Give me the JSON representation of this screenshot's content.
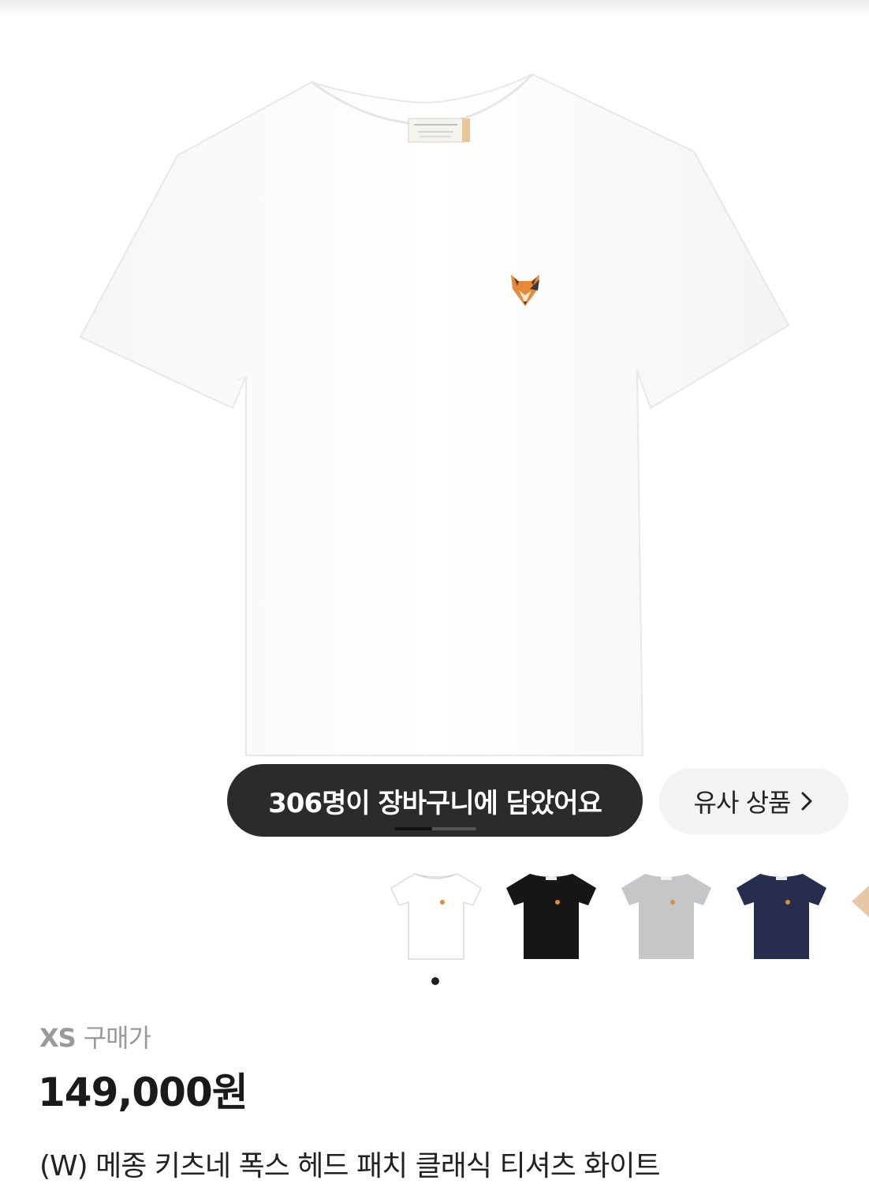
{
  "cart_banner": {
    "text": "306명이 장바구니에 담았어요"
  },
  "similar_button": {
    "label": "유사 상품",
    "icon": "chevron-right-icon"
  },
  "gallery": {
    "page_index": 1,
    "page_count": 2
  },
  "color_options": [
    {
      "name": "white",
      "color": "#ffffff"
    },
    {
      "name": "black",
      "color": "#161616"
    },
    {
      "name": "gray",
      "color": "#c4c6c8"
    },
    {
      "name": "navy",
      "color": "#262d4d"
    },
    {
      "name": "beige",
      "color": "#e6c9a4"
    }
  ],
  "color_dots": {
    "active_index": 0
  },
  "product": {
    "size": "XS",
    "price_label": "구매가",
    "price": "149,000원",
    "title": "(W) 메종 키츠네 폭스 헤드 패치 클래식 티셔츠 화이트"
  }
}
